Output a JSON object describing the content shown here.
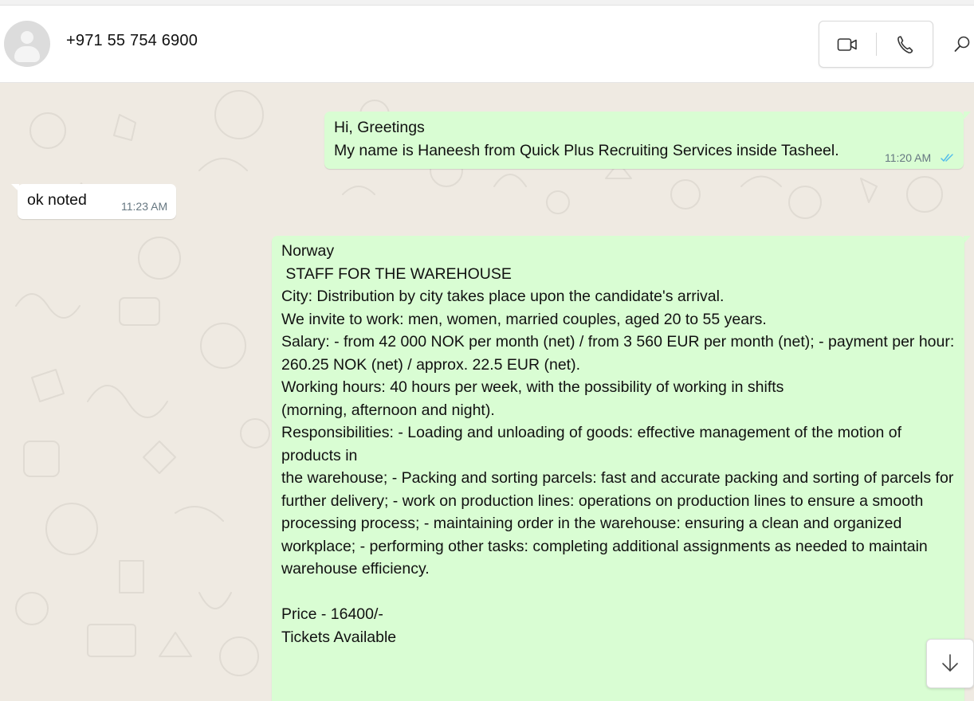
{
  "header": {
    "contact_name": "+971 55 754 6900",
    "icons": {
      "avatar": "default-avatar-icon",
      "video": "video-call-icon",
      "voice": "voice-call-icon",
      "search": "search-icon"
    }
  },
  "messages": [
    {
      "direction": "outgoing",
      "lines": [
        "Hi, Greetings",
        "My name is Haneesh from Quick Plus Recruiting Services inside Tasheel."
      ],
      "time": "11:20 AM",
      "status": "read"
    },
    {
      "direction": "incoming",
      "text": "ok noted",
      "time": "11:23 AM"
    },
    {
      "direction": "outgoing",
      "lines": [
        "Norway",
        " STAFF FOR THE WAREHOUSE",
        "City: Distribution by city takes place upon the candidate's arrival.",
        "We invite to work: men, women, married couples, aged 20 to 55 years.",
        "Salary: - from 42 000 NOK per month (net) / from 3 560 EUR per month (net); - payment per hour: 260.25 NOK (net) / approx. 22.5 EUR (net).",
        "Working hours: 40 hours per week, with the possibility of working in shifts",
        "(morning, afternoon and night).",
        "Responsibilities: - Loading and unloading of goods: effective management of the motion of products in",
        "the warehouse; - Packing and sorting parcels: fast and accurate packing and sorting of parcels for",
        "further delivery; - work on production lines: operations on production lines to ensure a smooth",
        "processing process; - maintaining order in the warehouse: ensuring a clean and organized",
        "workplace; - performing other tasks: completing additional assignments as needed to maintain",
        "warehouse efficiency.",
        "",
        "Price - 16400/-",
        "Tickets Available"
      ]
    }
  ],
  "controls": {
    "scroll_down_icon": "arrow-down-icon"
  },
  "colors": {
    "outgoing_bubble": "#d9fdd3",
    "incoming_bubble": "#ffffff",
    "read_ticks": "#53bdeb",
    "chat_background": "#efeae2"
  }
}
